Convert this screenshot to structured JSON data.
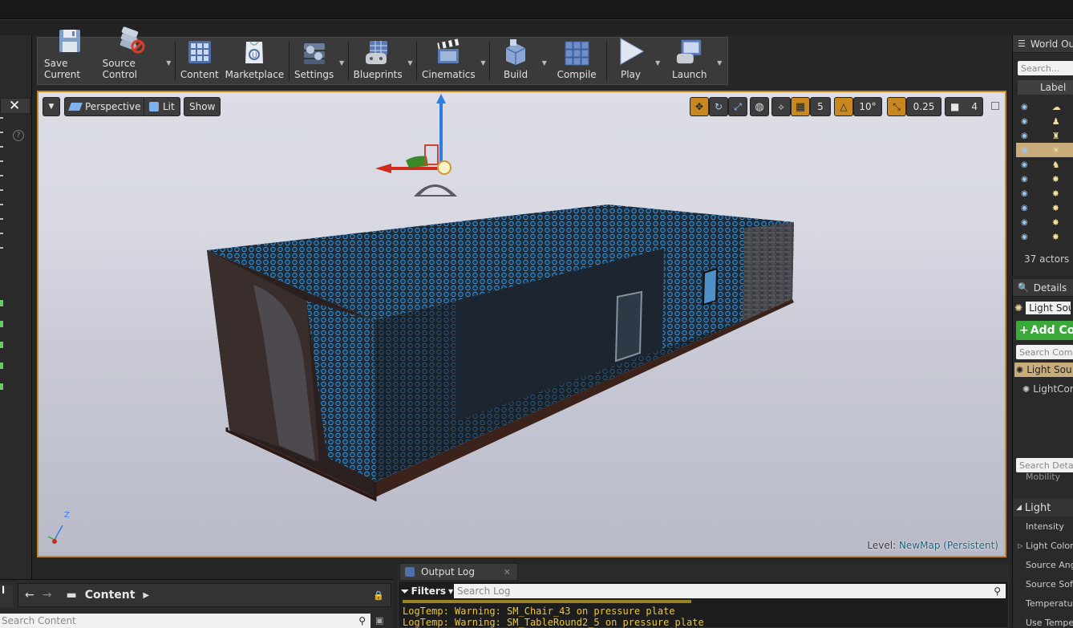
{
  "toolbar": {
    "buttons": [
      {
        "label": "Save Current",
        "icon": "save-icon"
      },
      {
        "label": "Source Control",
        "icon": "source-control-icon"
      },
      {
        "label": "Content",
        "icon": "content-icon"
      },
      {
        "label": "Marketplace",
        "icon": "marketplace-icon"
      },
      {
        "label": "Settings",
        "icon": "settings-icon"
      },
      {
        "label": "Blueprints",
        "icon": "blueprints-icon"
      },
      {
        "label": "Cinematics",
        "icon": "cinematics-icon"
      },
      {
        "label": "Build",
        "icon": "build-icon"
      },
      {
        "label": "Compile",
        "icon": "compile-icon"
      },
      {
        "label": "Play",
        "icon": "play-icon"
      },
      {
        "label": "Launch",
        "icon": "launch-icon"
      }
    ]
  },
  "viewport": {
    "perspective_label": "Perspective",
    "lit_label": "Lit",
    "show_label": "Show",
    "grid_snap": "5",
    "rotation_snap": "10°",
    "scale_snap": "0.25",
    "camera_speed": "4",
    "level_prefix": "Level:",
    "level_name": "NewMap (Persistent)",
    "axis_z": "Z"
  },
  "outliner": {
    "tab_title": "World Ou",
    "search_placeholder": "Search...",
    "column_label": "Label",
    "actor_count": "37 actors (",
    "row_count": 10,
    "selected_row": 3
  },
  "details": {
    "tab_title": "Details",
    "selected_actor": "Light Sou",
    "add_component": "Add Com",
    "search_components": "Search Comp",
    "component_root": "Light Sou",
    "component_child": "LightCom",
    "search_details": "Search Deta",
    "mobility": "Mobility",
    "category": "Light",
    "props": [
      "Intensity",
      "Light Color",
      "Source Angl",
      "Source Soft",
      "Temperatur",
      "Use Temper"
    ]
  },
  "content_browser": {
    "path_label": "Content",
    "search_placeholder": "Search Content"
  },
  "output_log": {
    "tab_title": "Output Log",
    "filters_label": "Filters",
    "search_placeholder": "Search Log",
    "lines": [
      "LogTemp: Warning: SM_Chair_43 on pressure plate",
      "LogTemp: Warning: SM_TableRound2_5 on pressure plate"
    ]
  },
  "colors": {
    "accent_orange": "#c8871f",
    "selection_blue": "#1a5f7a",
    "log_warning": "#f0c62a",
    "add_button_green": "#3aa93a"
  }
}
